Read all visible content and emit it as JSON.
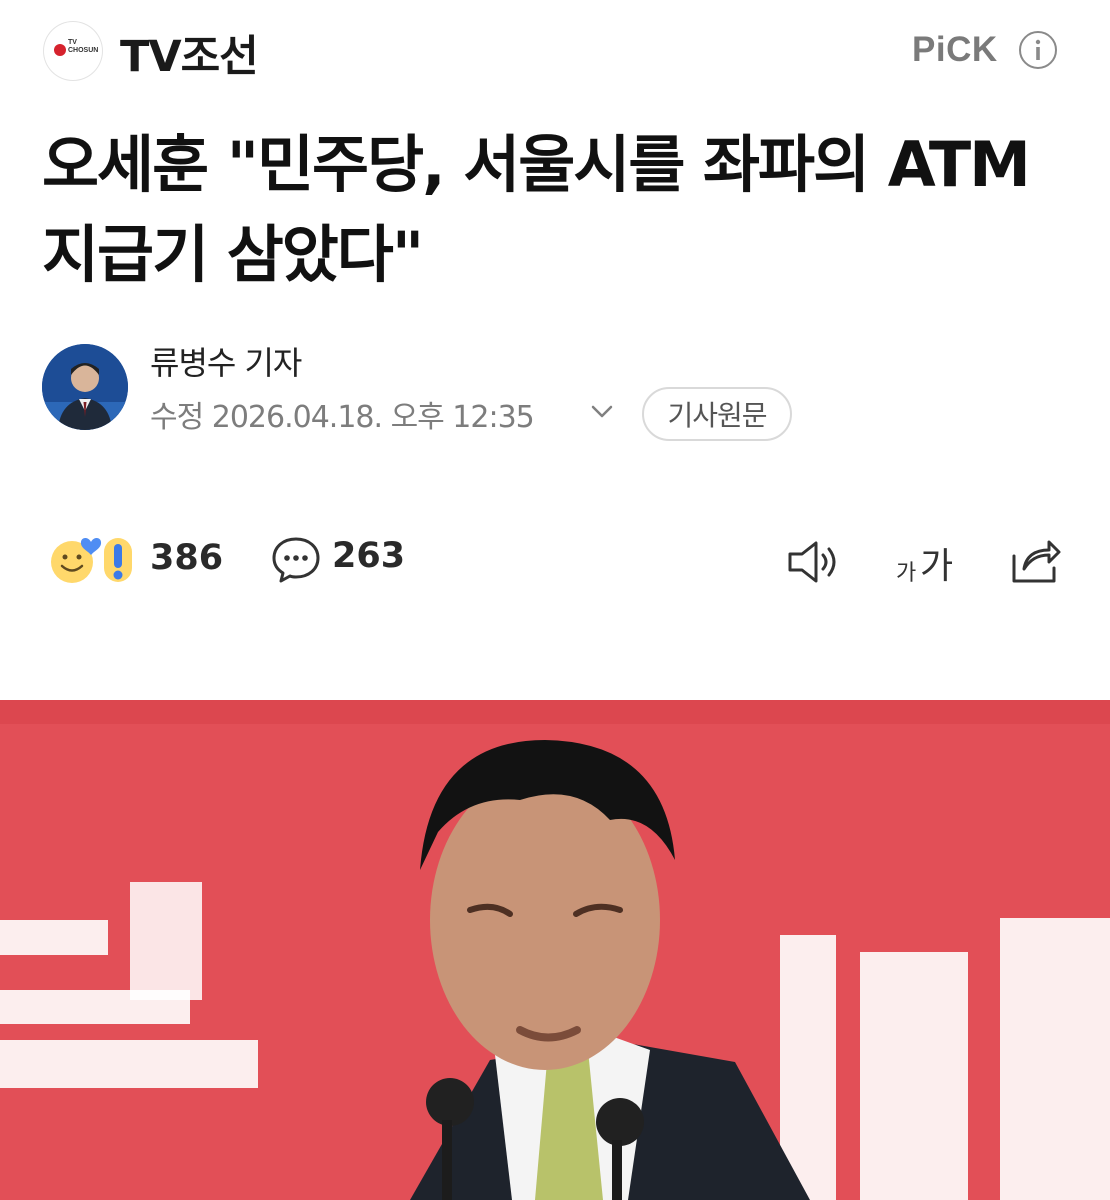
{
  "header": {
    "logo_icon": "tv-chosun-logo-icon",
    "logo_text": "TV\nCHOSUN",
    "press_name": "TV조선",
    "pick_label": "PiCK",
    "info_icon": "info-icon"
  },
  "article": {
    "headline": "오세훈 \"민주당, 서울시를 좌파의 ATM 지급기 삼았다\"",
    "reporter": {
      "name": "류병수 기자",
      "avatar_icon": "reporter-avatar"
    },
    "timestamp": "수정 2026.04.18. 오후 12:35",
    "original_button": "기사원문"
  },
  "actions": {
    "reaction_count": "386",
    "comment_count": "263",
    "icons": [
      "reaction-icon",
      "comment-icon",
      "speaker-icon",
      "font-size-icon",
      "share-icon"
    ]
  },
  "photo": {
    "background_color": "#e24f57"
  }
}
